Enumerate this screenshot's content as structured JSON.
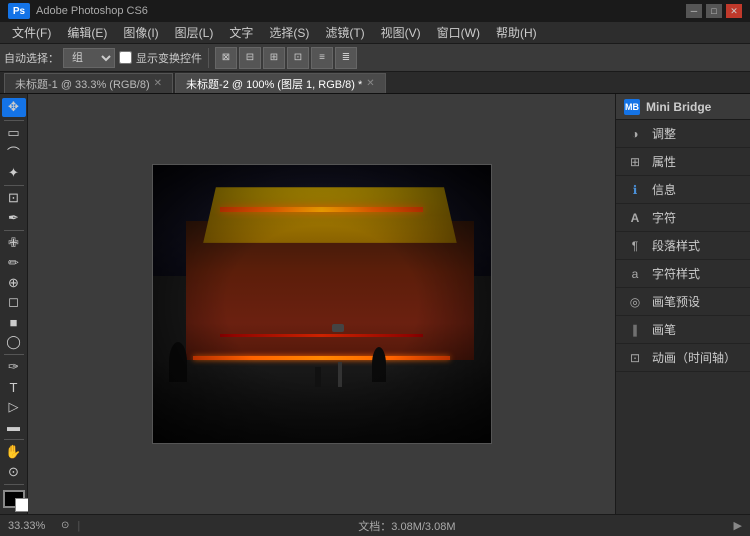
{
  "titlebar": {
    "logo": "Ps",
    "title": "Adobe Photoshop CS6",
    "min": "─",
    "max": "□",
    "close": "✕"
  },
  "menu": {
    "items": [
      "文件(F)",
      "编辑(E)",
      "图像(I)",
      "图层(L)",
      "文字",
      "选择(S)",
      "滤镜(T)",
      "视图(V)",
      "窗口(W)",
      "帮助(H)"
    ]
  },
  "options": {
    "auto_select_label": "自动选择：",
    "auto_select_value": "组",
    "show_transform": "显示变换控件"
  },
  "tabs": [
    {
      "label": "未标题-1 @ 33.3% (RGB/8)",
      "active": false,
      "modified": false
    },
    {
      "label": "未标题-2 @ 100% (图层 1, RGB/8)",
      "active": true,
      "modified": true
    }
  ],
  "tools": [
    {
      "name": "move",
      "icon": "✥"
    },
    {
      "name": "select-rect",
      "icon": "▭"
    },
    {
      "name": "lasso",
      "icon": "⌒"
    },
    {
      "name": "magic-wand",
      "icon": "✦"
    },
    {
      "name": "crop",
      "icon": "⊡"
    },
    {
      "name": "eyedropper",
      "icon": "✒"
    },
    {
      "name": "heal",
      "icon": "✙"
    },
    {
      "name": "brush",
      "icon": "✏"
    },
    {
      "name": "clone",
      "icon": "⊕"
    },
    {
      "name": "eraser",
      "icon": "◻"
    },
    {
      "name": "gradient",
      "icon": "■"
    },
    {
      "name": "dodge",
      "icon": "◯"
    },
    {
      "name": "pen",
      "icon": "✑"
    },
    {
      "name": "text",
      "icon": "T"
    },
    {
      "name": "path-select",
      "icon": "▷"
    },
    {
      "name": "shape",
      "icon": "▬"
    },
    {
      "name": "hand",
      "icon": "✋"
    },
    {
      "name": "zoom",
      "icon": "⊙"
    }
  ],
  "right_panel": {
    "header": {
      "icon_text": "MB",
      "title": "Mini Bridge"
    },
    "items": [
      {
        "name": "调整",
        "icon": "◑"
      },
      {
        "name": "属性",
        "icon": "⊞"
      },
      {
        "name": "信息",
        "icon": "ℹ"
      },
      {
        "name": "字符",
        "icon": "A"
      },
      {
        "name": "段落样式",
        "icon": "¶"
      },
      {
        "name": "字符样式",
        "icon": "A"
      },
      {
        "name": "画笔预设",
        "icon": "◎"
      },
      {
        "name": "画笔",
        "icon": "∥"
      },
      {
        "name": "动画（时间轴）",
        "icon": "⊡"
      }
    ]
  },
  "statusbar": {
    "zoom": "33.33%",
    "info_label": "文档：3.08M/3.08M",
    "arrow": "▶"
  }
}
